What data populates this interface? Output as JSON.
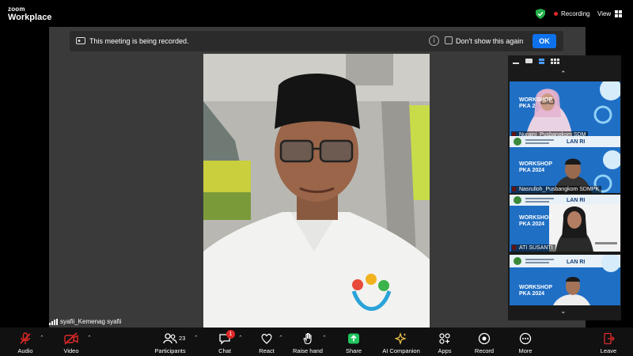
{
  "app": {
    "brand_top": "zoom",
    "brand_bottom": "Workplace"
  },
  "header": {
    "recording_label": "Recording",
    "view_label": "View"
  },
  "banner": {
    "message": "This meeting is being recorded.",
    "dont_show": "Don't show this again",
    "ok_label": "OK"
  },
  "main_video": {
    "participant_name": "syafii_Kemenag syafii"
  },
  "gallery": {
    "tiles": [
      {
        "name": "Nuraini_Pusbangkom SDM",
        "slide_title_1": "WORKSHOP",
        "slide_title_2": "PKA 2",
        "muted": true
      },
      {
        "name": "Nasrulloh_Pusbangkom SDMPK",
        "slide_title_1": "WORKSHOP",
        "slide_title_2": "PKA 2024",
        "org": "LAN RI",
        "muted": true
      },
      {
        "name": "ATI SUSANTI",
        "slide_title_1": "WORKSHOP",
        "slide_title_2": "PKA 2024",
        "org": "LAN RI",
        "muted": true
      },
      {
        "name": "",
        "slide_title_1": "WORKSHOP",
        "slide_title_2": "PKA 2024",
        "org": "LAN RI",
        "muted": false
      }
    ]
  },
  "toolbar": {
    "audio": "Audio",
    "video": "Video",
    "participants": "Participants",
    "participants_count": "23",
    "chat": "Chat",
    "chat_badge": "1",
    "react": "React",
    "raise_hand": "Raise hand",
    "share": "Share",
    "ai_companion": "AI Companion",
    "apps": "Apps",
    "record": "Record",
    "more": "More",
    "leave": "Leave"
  },
  "colors": {
    "accent": "#0e72ed",
    "danger": "#e02828",
    "share_green": "#21c55d",
    "slide_blue": "#1e73c8"
  }
}
